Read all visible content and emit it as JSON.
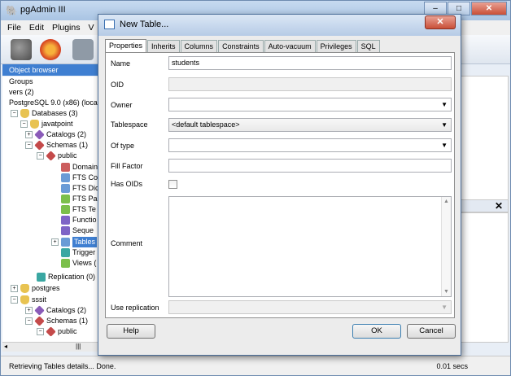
{
  "app": {
    "title": "pgAdmin III"
  },
  "menu": [
    "File",
    "Edit",
    "Plugins",
    "V"
  ],
  "object_browser": {
    "header": "Object browser",
    "tree": [
      {
        "label": "Groups",
        "indent": 0
      },
      {
        "label": "vers (2)",
        "indent": 0
      },
      {
        "label": "PostgreSQL 9.0 (x86) (local",
        "indent": 0
      },
      {
        "label": "Databases (3)",
        "indent": 1
      },
      {
        "label": "javatpoint",
        "indent": 2
      },
      {
        "label": "Catalogs (2)",
        "indent": 3
      },
      {
        "label": "Schemas (1)",
        "indent": 3
      },
      {
        "label": "public",
        "indent": 4
      },
      {
        "label": "Domain",
        "indent": 5
      },
      {
        "label": "FTS Co",
        "indent": 5
      },
      {
        "label": "FTS Dic",
        "indent": 5
      },
      {
        "label": "FTS Pa",
        "indent": 5
      },
      {
        "label": "FTS Te",
        "indent": 5
      },
      {
        "label": "Functio",
        "indent": 5
      },
      {
        "label": "Seque",
        "indent": 5
      },
      {
        "label": "Tables",
        "indent": 5,
        "selected": true
      },
      {
        "label": "Trigger",
        "indent": 5
      },
      {
        "label": "Views (",
        "indent": 5
      },
      {
        "label": "Replication (0)",
        "indent": 3
      },
      {
        "label": "postgres",
        "indent": 1
      },
      {
        "label": "sssit",
        "indent": 1
      },
      {
        "label": "Catalogs (2)",
        "indent": 3
      },
      {
        "label": "Schemas (1)",
        "indent": 3
      },
      {
        "label": "public",
        "indent": 4
      }
    ]
  },
  "status": {
    "left": "Retrieving Tables details... Done.",
    "right": "0.01 secs"
  },
  "dialog": {
    "title": "New Table...",
    "tabs": [
      "Properties",
      "Inherits",
      "Columns",
      "Constraints",
      "Auto-vacuum",
      "Privileges",
      "SQL"
    ],
    "fields": {
      "name_label": "Name",
      "name_value": "students",
      "oid_label": "OID",
      "owner_label": "Owner",
      "tablespace_label": "Tablespace",
      "tablespace_value": "<default tablespace>",
      "oftype_label": "Of type",
      "fillfactor_label": "Fill Factor",
      "hasoids_label": "Has OIDs",
      "comment_label": "Comment",
      "replication_label": "Use replication"
    },
    "buttons": {
      "help": "Help",
      "ok": "OK",
      "cancel": "Cancel"
    }
  }
}
